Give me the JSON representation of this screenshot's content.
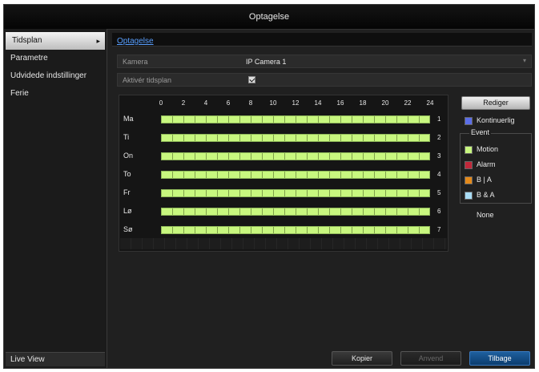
{
  "window": {
    "title": "Optagelse"
  },
  "sidebar": {
    "items": [
      {
        "label": "Tidsplan",
        "active": true
      },
      {
        "label": "Parametre",
        "active": false
      },
      {
        "label": "Udvidede indstillinger",
        "active": false
      },
      {
        "label": "Ferie",
        "active": false
      }
    ],
    "bottom_label": "Live View"
  },
  "breadcrumb": {
    "tab": "Optagelse"
  },
  "camera_row": {
    "label": "Kamera",
    "value": "IP Camera 1"
  },
  "schedule_row": {
    "label": "Aktivér tidsplan",
    "checked": true
  },
  "schedule": {
    "hours": [
      "0",
      "2",
      "4",
      "6",
      "8",
      "10",
      "12",
      "14",
      "16",
      "18",
      "20",
      "22",
      "24"
    ],
    "days": [
      {
        "label": "Ma",
        "num": "1"
      },
      {
        "label": "Ti",
        "num": "2"
      },
      {
        "label": "On",
        "num": "3"
      },
      {
        "label": "To",
        "num": "4"
      },
      {
        "label": "Fr",
        "num": "5"
      },
      {
        "label": "Lø",
        "num": "6"
      },
      {
        "label": "Sø",
        "num": "7"
      }
    ],
    "fill_color": "#c8f77f"
  },
  "legend": {
    "edit_button": "Rediger",
    "continuous": {
      "label": "Kontinuerlig",
      "color": "#5b6ee8"
    },
    "event_title": "Event",
    "events": [
      {
        "label": "Motion",
        "color": "#c8f77f"
      },
      {
        "label": "Alarm",
        "color": "#c0283a"
      },
      {
        "label": "B | A",
        "color": "#e58a1a"
      },
      {
        "label": "B & A",
        "color": "#a9dcf5"
      }
    ],
    "none": {
      "label": "None",
      "color": "#202020"
    }
  },
  "footer": {
    "copy": "Kopier",
    "apply": "Anvend",
    "back": "Tilbage"
  }
}
